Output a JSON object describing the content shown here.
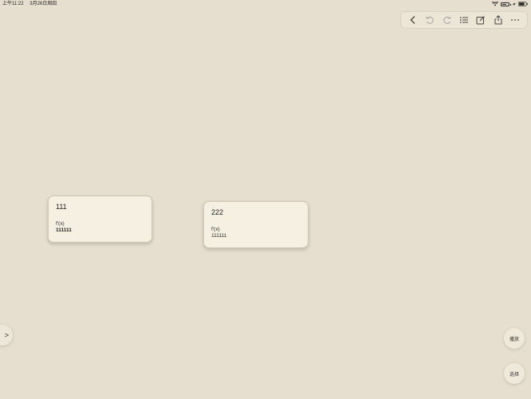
{
  "status_bar": {
    "time": "上午11:22",
    "date": "3月26日周四"
  },
  "toolbar": {
    "icons": [
      "back-icon",
      "undo-icon",
      "redo-icon",
      "list-icon",
      "edit-icon",
      "share-icon",
      "more-icon"
    ],
    "more_label": "···"
  },
  "cards": [
    {
      "title": "111",
      "line1": "f'(x)",
      "line2": "111111"
    },
    {
      "title": "222",
      "line1": "f'(x)",
      "line2": "111111"
    }
  ],
  "sidebar_toggle": {
    "label": ">"
  },
  "buttons": {
    "top_label": "播放",
    "bottom_label": "选择"
  },
  "colors": {
    "background": "#e6dfcf",
    "card": "#f5f0e2",
    "toolbar": "#ece6d7"
  }
}
